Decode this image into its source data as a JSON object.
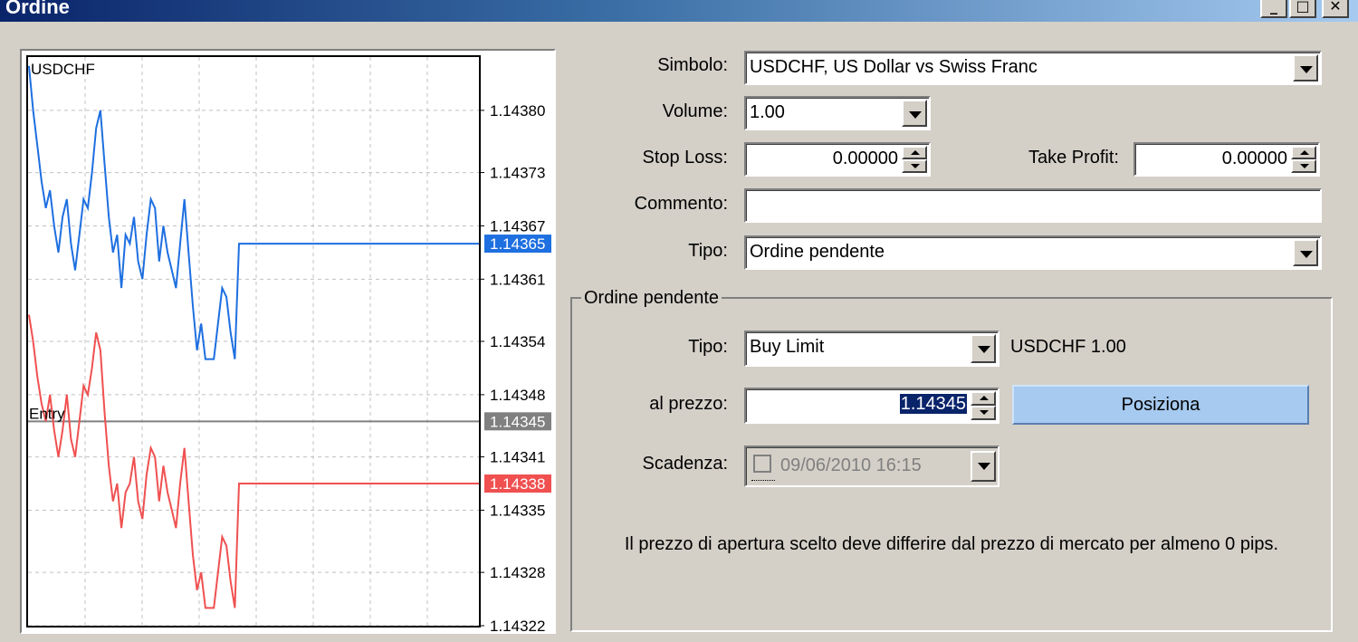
{
  "window": {
    "title": "Ordine",
    "minimize": "_",
    "maximize": "□",
    "close": "✕"
  },
  "chart": {
    "symbol": "USDCHF",
    "entry_label": "Entry",
    "tick_labels": [
      "1.14380",
      "1.14373",
      "1.14367",
      "1.14361",
      "1.14354",
      "1.14348",
      "1.14341",
      "1.14335",
      "1.14328",
      "1.14322"
    ],
    "tag_ask": "1.14365",
    "tag_entry": "1.14345",
    "tag_bid": "1.14338",
    "colors": {
      "ask": "#1e6fe0",
      "bid": "#f05050",
      "entry": "#808080"
    }
  },
  "chart_data": {
    "type": "line",
    "ylim": [
      1.14322,
      1.14386
    ],
    "series": [
      {
        "values": [
          1.14385,
          1.1438,
          1.14376,
          1.14372,
          1.14369,
          1.14371,
          1.14367,
          1.14364,
          1.14368,
          1.1437,
          1.14365,
          1.14362,
          1.14366,
          1.1437,
          1.14369,
          1.14373,
          1.14378,
          1.1438,
          1.14374,
          1.14368,
          1.14364,
          1.14366,
          1.1436,
          1.14366,
          1.14365,
          1.14368,
          1.14363,
          1.14361,
          1.14366,
          1.1437,
          1.14369,
          1.14363,
          1.14367,
          1.14364,
          1.14362,
          1.1436,
          1.14365,
          1.1437,
          1.14364,
          1.14358,
          1.14353,
          1.14356,
          1.14352,
          1.14352,
          1.14352,
          1.14356,
          1.1436,
          1.14359,
          1.14355,
          1.14352,
          1.14365,
          1.14365
        ]
      },
      {
        "values": [
          1.14357,
          1.14354,
          1.1435,
          1.14347,
          1.14345,
          1.14348,
          1.14344,
          1.14341,
          1.14344,
          1.14348,
          1.14343,
          1.14341,
          1.14345,
          1.14349,
          1.14348,
          1.14351,
          1.14355,
          1.14353,
          1.14346,
          1.1434,
          1.14336,
          1.14338,
          1.14333,
          1.14337,
          1.14338,
          1.14341,
          1.14336,
          1.14334,
          1.14339,
          1.14342,
          1.14341,
          1.14336,
          1.1434,
          1.14337,
          1.14335,
          1.14333,
          1.14338,
          1.14342,
          1.14336,
          1.1433,
          1.14326,
          1.14328,
          1.14324,
          1.14324,
          1.14324,
          1.14328,
          1.14332,
          1.14331,
          1.14327,
          1.14324,
          1.14338,
          1.14338
        ]
      }
    ],
    "entry_value": 1.14345
  },
  "form": {
    "simbolo_label": "Simbolo:",
    "simbolo_value": "USDCHF, US Dollar vs Swiss Franc",
    "volume_label": "Volume:",
    "volume_value": "1.00",
    "stoploss_label": "Stop Loss:",
    "stoploss_value": "0.00000",
    "takeprofit_label": "Take Profit:",
    "takeprofit_value": "0.00000",
    "commento_label": "Commento:",
    "commento_value": "",
    "tipo_label": "Tipo:",
    "tipo_value": "Ordine pendente"
  },
  "pending": {
    "group_title": "Ordine pendente",
    "tipo_label": "Tipo:",
    "tipo_value": "Buy Limit",
    "order_summary": "USDCHF 1.00",
    "prezzo_label": "al prezzo:",
    "prezzo_value": "1.14345",
    "posiziona_label": "Posiziona",
    "scadenza_label": "Scadenza:",
    "scadenza_value": "09/06/2010 16:15",
    "info_text": "Il prezzo di apertura scelto deve differire dal prezzo di mercato per almeno 0 pips."
  }
}
